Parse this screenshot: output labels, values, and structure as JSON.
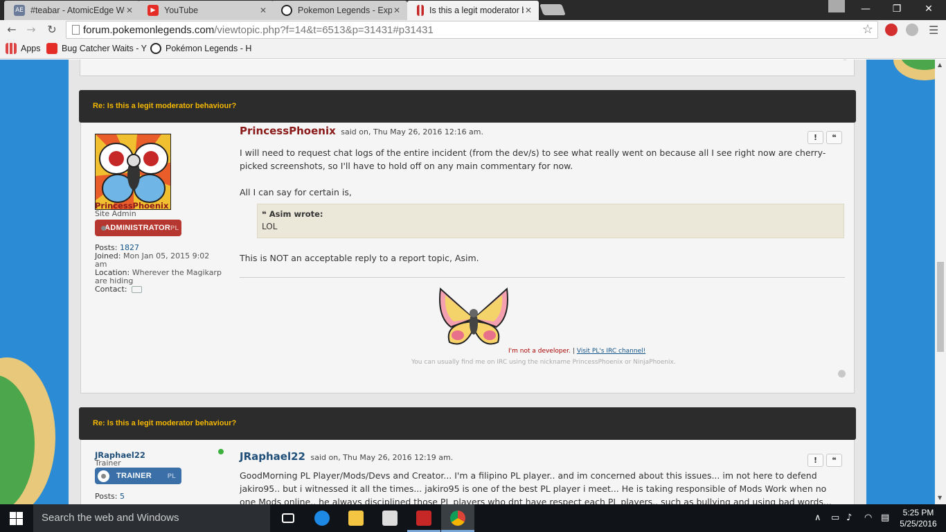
{
  "browser": {
    "tabs": [
      {
        "title": "#teabar - AtomicEdge We",
        "icon": "atomicedge-icon",
        "active": false
      },
      {
        "title": "YouTube",
        "icon": "youtube-icon",
        "active": false
      },
      {
        "title": "Pokemon Legends - Explo",
        "icon": "pokeball-icon",
        "active": false
      },
      {
        "title": "Is this a legit moderator b",
        "icon": "loading-icon",
        "active": true
      }
    ],
    "url_host": "forum.pokemonlegends.com",
    "url_path": "/viewtopic.php?f=14&t=6513&p=31431#p31431",
    "bookmarks": [
      {
        "label": "Apps",
        "icon": "apps-grid-icon"
      },
      {
        "label": "Bug Catcher Waits - Y",
        "icon": "youtube-icon"
      },
      {
        "label": "Pokémon Legends - H",
        "icon": "pokeball-icon"
      }
    ]
  },
  "posts": [
    {
      "subject": "Re: Is this a legit moderator behaviour?",
      "author": "PrincessPhoenix",
      "author_color": "#8b1a1a",
      "rank": "Site Admin",
      "rank_badge": "ADMINISTRATOR",
      "rank_badge_tag": "PL",
      "rank_badge_color": "#b5372f",
      "stats": {
        "posts_label": "Posts:",
        "posts": "1827",
        "joined_label": "Joined:",
        "joined": "Mon Jan 05, 2015 9:02 am",
        "location_label": "Location:",
        "location": "Wherever the Magikarp are hiding",
        "contact_label": "Contact:"
      },
      "said_on": "said on, Thu May 26, 2016 12:16 am.",
      "report_label": "!",
      "quote_label": "❝",
      "paragraph1": "I will need to request chat logs of the entire incident (from the dev/s) to see what really went on because all I see right now are cherry-picked screenshots, so I'll have to hold off on any main commentary for now.",
      "paragraph2": "All I can say for certain is,",
      "quote_author": "Asim wrote:",
      "quote_text": "LOL",
      "paragraph3": "This is NOT an acceptable reply to a report topic, Asim.",
      "signature_line1": "I'm not a developer.",
      "signature_link": "Visit PL's IRC channel!",
      "signature_line2": "You can usually find me on IRC using the nickname PrincessPhoenix or NinjaPhoenix."
    },
    {
      "subject": "Re: Is this a legit moderator behaviour?",
      "author": "JRaphael22",
      "author_color": "#1f4e79",
      "rank": "Trainer",
      "rank_badge": "TRAINER",
      "rank_badge_tag": "PL",
      "rank_badge_color": "#3a6fa8",
      "stats": {
        "posts_label": "Posts:",
        "posts": "5"
      },
      "said_on": "said on, Thu May 26, 2016 12:19 am.",
      "report_label": "!",
      "quote_label": "❝",
      "paragraph1": "GoodMorning PL Player/Mods/Devs and Creator... I'm a filipino PL player.. and im concerned about this issues... im not here to defend jakiro95.. but i witnessed it all the times... jakiro95 is one of the best PL player i meet... He is taking responsible of Mods Work when no one Mods online.. he always disciplined those PL players who dnt have respect each PL players.. such as bullying and using bad words..."
    }
  ],
  "taskbar": {
    "search_placeholder": "Search the web and Windows",
    "time": "5:25 PM",
    "date": "5/25/2016"
  }
}
